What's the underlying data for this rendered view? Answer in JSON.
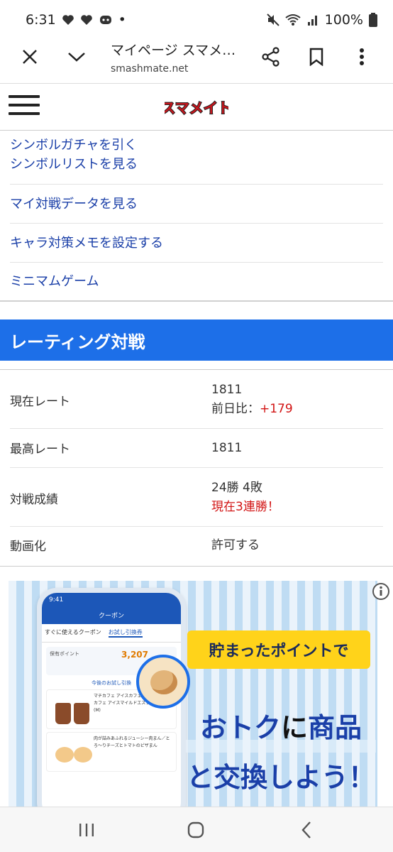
{
  "status_bar": {
    "time": "6:31",
    "dot": "•",
    "battery": "100%"
  },
  "browser": {
    "title": "マイページ スマメ…",
    "url": "smashmate.net"
  },
  "site": {
    "logo_text": "スマメイト"
  },
  "menu": {
    "items": [
      {
        "label": "シンボルガチャを引く"
      },
      {
        "label": "シンボルリストを見る"
      },
      {
        "label": "マイ対戦データを見る"
      },
      {
        "label": "キャラ対策メモを設定する"
      },
      {
        "label": "ミニマムゲーム"
      }
    ]
  },
  "rating": {
    "section_title": "レーティング対戦",
    "rows": [
      {
        "label": "現在レート",
        "value": "1811",
        "sub_prefix": "前日比：",
        "sub_value": "+179"
      },
      {
        "label": "最高レート",
        "value": "1811"
      },
      {
        "label": "対戦成績",
        "value": "24勝 4敗",
        "sub_value": "現在3連勝！"
      },
      {
        "label": "動画化",
        "value": "許可する"
      }
    ]
  },
  "ad": {
    "banner": "貯まったポイントで",
    "headline_1a": "おトク",
    "headline_1b": "に",
    "headline_1c": "商品",
    "headline_2": "と交換しよう！",
    "phone": {
      "time": "9:41",
      "header": "クーポン",
      "tab_1": "すぐに使えるクーポン",
      "tab_2": "お試し引換券",
      "points_value": "3,207",
      "points_label": "保有ポイント",
      "link": "今後のお試し引換",
      "item_1": "マチカフェ アイスカフェラテ(M)・マチカフェ アイスマイルドエスプレッソラテ(M)",
      "item_2": "肉が詰みあふれるジューシー肉まん／とろ〜りチーズとトマトのピザまん"
    }
  },
  "colors": {
    "link": "#1a3fa8",
    "section_bg": "#1d6fe8",
    "accent_red": "#d21414"
  }
}
